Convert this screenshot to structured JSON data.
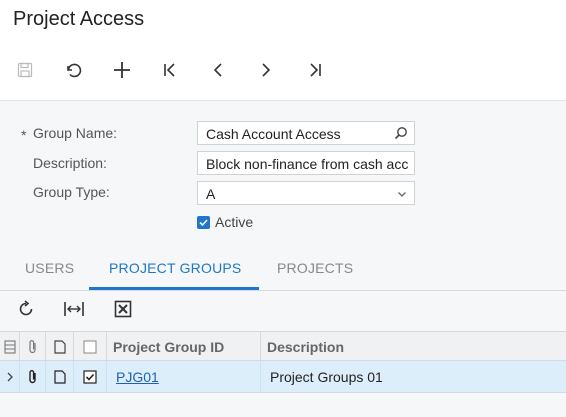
{
  "page": {
    "title": "Project Access"
  },
  "toolbar": {
    "icons": [
      "save-icon",
      "undo-icon",
      "add-icon",
      "first-record-icon",
      "previous-icon",
      "next-icon",
      "last-record-icon"
    ]
  },
  "form": {
    "required_marker": "*",
    "group_name": {
      "label": "Group Name:",
      "value": "Cash Account Access"
    },
    "description": {
      "label": "Description:",
      "value": "Block non-finance from cash acc"
    },
    "group_type": {
      "label": "Group Type:",
      "value": "A"
    },
    "active": {
      "label": "Active",
      "checked": true
    }
  },
  "tabs": [
    {
      "label": "USERS",
      "active": false
    },
    {
      "label": "PROJECT GROUPS",
      "active": true
    },
    {
      "label": "PROJECTS",
      "active": false
    }
  ],
  "grid": {
    "toolbar_icons": [
      "refresh-icon",
      "fit-columns-icon",
      "export-excel-icon"
    ],
    "columns": [
      "Project Group ID",
      "Description"
    ],
    "rows": [
      {
        "project_group_id": "PJG01",
        "description": "Project Groups 01",
        "included": true
      }
    ]
  },
  "colors": {
    "accent": "#1f77c9",
    "selected_row": "#ddeefb",
    "panel": "#f6f7f8"
  }
}
